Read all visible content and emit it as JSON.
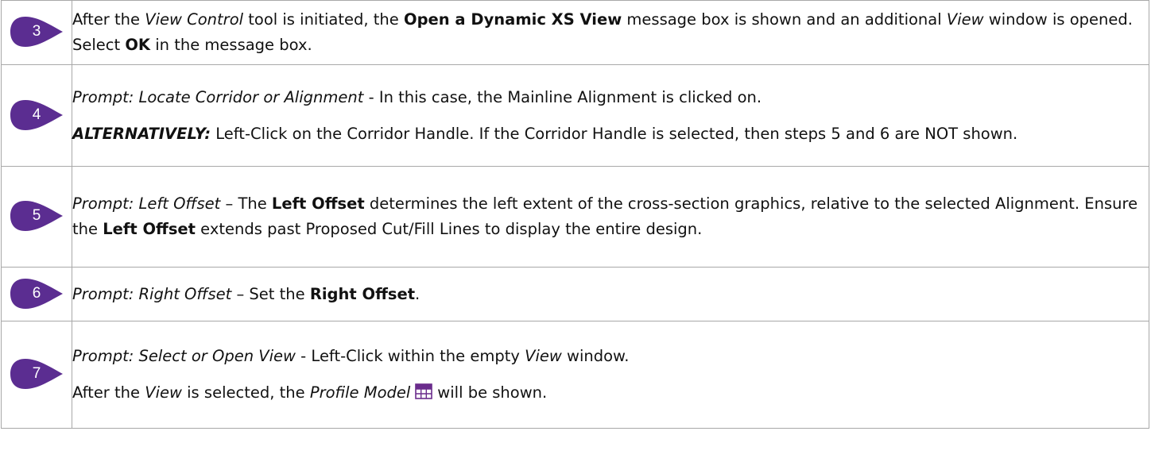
{
  "steps": [
    {
      "number": "3",
      "paragraphs": [
        [
          {
            "t": "After the "
          },
          {
            "t": "View Control",
            "s": "i"
          },
          {
            "t": " tool is initiated, the "
          },
          {
            "t": "Open a Dynamic XS View",
            "s": "b"
          },
          {
            "t": " message box is shown and an additional "
          },
          {
            "t": "View",
            "s": "i"
          },
          {
            "t": " window is opened.  Select "
          },
          {
            "t": "OK",
            "s": "b"
          },
          {
            "t": " in the message box."
          }
        ]
      ]
    },
    {
      "number": "4",
      "paragraphs": [
        [
          {
            "t": "Prompt:  Locate Corridor or Alignment",
            "s": "i"
          },
          {
            "t": " - In this case, the Mainline Alignment is clicked on."
          }
        ],
        [
          {
            "t": "ALTERNATIVELY:",
            "s": "bi"
          },
          {
            "t": " Left-Click on the Corridor Handle.  If the Corridor Handle is selected, then steps 5 and 6 are NOT shown."
          }
        ]
      ]
    },
    {
      "number": "5",
      "paragraphs": [
        [
          {
            "t": "Prompt:  Left Offset",
            "s": "i"
          },
          {
            "t": " – The "
          },
          {
            "t": "Left Offset",
            "s": "b"
          },
          {
            "t": " determines the left extent of the cross-section graphics, relative to the selected Alignment.  Ensure the "
          },
          {
            "t": "Left Offset",
            "s": "b"
          },
          {
            "t": " extends past Proposed Cut/Fill Lines to display the entire design."
          }
        ]
      ]
    },
    {
      "number": "6",
      "paragraphs": [
        [
          {
            "t": "Prompt:  Right Offset",
            "s": "i"
          },
          {
            "t": " – Set the "
          },
          {
            "t": "Right Offset",
            "s": "b"
          },
          {
            "t": "."
          }
        ]
      ]
    },
    {
      "number": "7",
      "paragraphs": [
        [
          {
            "t": "Prompt:  Select or Open View",
            "s": "i"
          },
          {
            "t": " - Left-Click within the empty "
          },
          {
            "t": "View",
            "s": "i"
          },
          {
            "t": " window."
          }
        ],
        [
          {
            "t": "After the "
          },
          {
            "t": "View",
            "s": "i"
          },
          {
            "t": " is selected, the "
          },
          {
            "t": "Profile Model",
            "s": "i"
          },
          {
            "icon": "profile-model-grid-icon"
          },
          {
            "t": "will be shown."
          }
        ]
      ]
    }
  ],
  "colors": {
    "badge": "#5b2d91",
    "border": "#a8a8a8",
    "icon": "#6a2c8c"
  }
}
